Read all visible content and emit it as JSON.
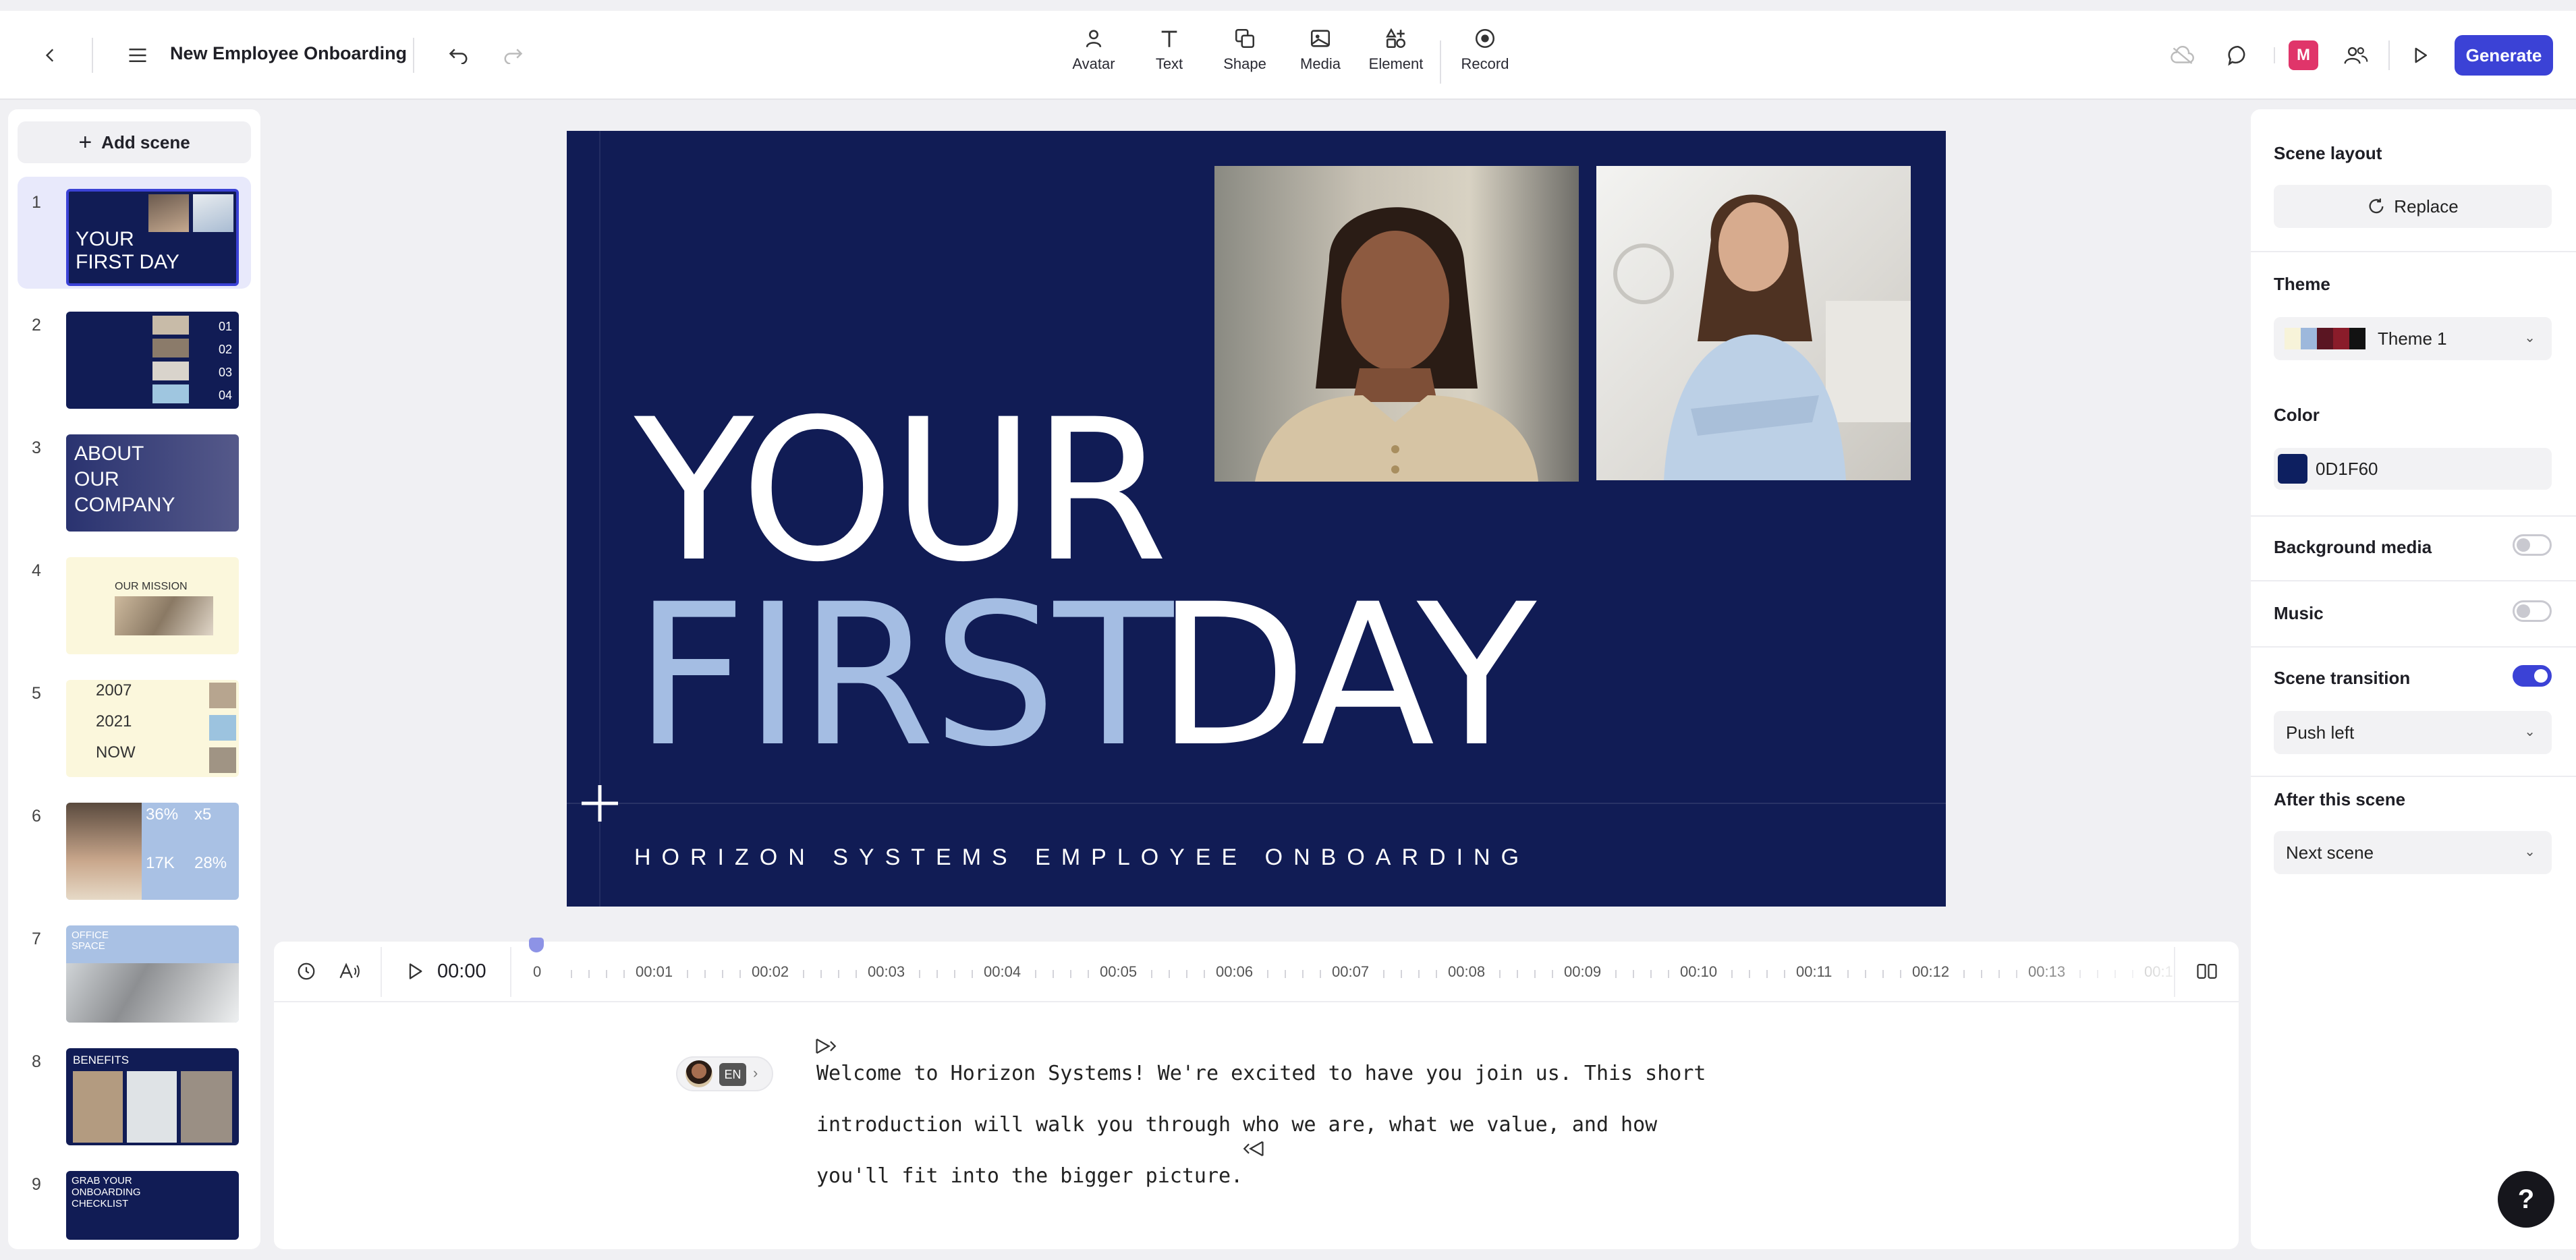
{
  "header": {
    "title": "New Employee Onboarding",
    "tools": [
      "Avatar",
      "Text",
      "Shape",
      "Media",
      "Element",
      "Record"
    ],
    "user_initial": "M",
    "generate_label": "Generate"
  },
  "scenes": {
    "add_label": "Add scene",
    "items": [
      {
        "num": "1",
        "lines": [
          "YOUR",
          "FIRST DAY"
        ]
      },
      {
        "num": "2",
        "lines": [
          "01",
          "02",
          "03",
          "04"
        ]
      },
      {
        "num": "3",
        "lines": [
          "ABOUT",
          "OUR",
          "COMPANY"
        ]
      },
      {
        "num": "4",
        "lines": [
          "OUR MISSION"
        ]
      },
      {
        "num": "5",
        "lines": [
          "2007",
          "2021",
          "NOW"
        ]
      },
      {
        "num": "6",
        "lines": [
          "36%",
          "x5",
          "17K",
          "28%"
        ]
      },
      {
        "num": "7",
        "lines": [
          "OFFICE",
          "SPACE"
        ]
      },
      {
        "num": "8",
        "lines": [
          "BENEFITS"
        ]
      },
      {
        "num": "9",
        "lines": [
          "GRAB YOUR",
          "ONBOARDING",
          "CHECKLIST"
        ]
      }
    ]
  },
  "slide": {
    "line1": "YOUR",
    "line2a": "FIRST",
    "line2b": "DAY",
    "subtitle": "HORIZON SYSTEMS EMPLOYEE ONBOARDING"
  },
  "timeline": {
    "time": "00:00",
    "ticks": [
      "0",
      "00:01",
      "00:02",
      "00:03",
      "00:04",
      "00:05",
      "00:06",
      "00:07",
      "00:08",
      "00:09",
      "00:10",
      "00:11",
      "00:12",
      "00:13",
      "00:1"
    ],
    "language": "EN",
    "script_lines": [
      "Welcome to Horizon Systems! We're excited to have you join us. This short",
      "introduction will walk you through who we are, what we value, and how",
      "you'll fit into the bigger picture."
    ]
  },
  "right_panel": {
    "scene_layout_label": "Scene layout",
    "replace_label": "Replace",
    "theme_label": "Theme",
    "theme_value": "Theme 1",
    "theme_swatches": [
      "#f7f3d9",
      "#9db8dc",
      "#5a1522",
      "#8a1c2a",
      "#121212"
    ],
    "color_label": "Color",
    "color_value": "0D1F60",
    "color_hex": "#0D1F60",
    "background_media_label": "Background media",
    "background_media_on": false,
    "music_label": "Music",
    "music_on": false,
    "scene_transition_label": "Scene transition",
    "scene_transition_on": true,
    "transition_value": "Push left",
    "after_scene_label": "After this scene",
    "after_scene_value": "Next scene"
  },
  "colors": {
    "accent": "#3b42d6",
    "slide_bg": "#111c55",
    "slide_text": "#ffffff",
    "slide_text_accent": "#a4bde3"
  }
}
